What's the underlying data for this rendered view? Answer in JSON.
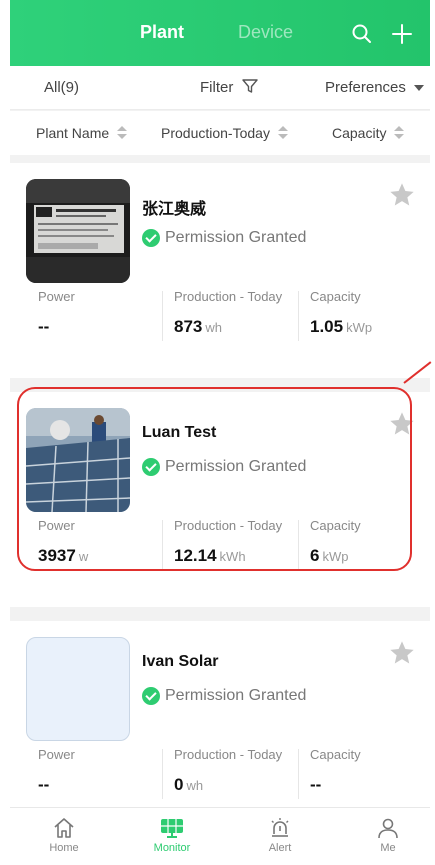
{
  "header": {
    "tab_plant": "Plant",
    "tab_device": "Device"
  },
  "filters": {
    "all": "All(9)",
    "filter": "Filter",
    "preferences": "Preferences"
  },
  "sort": {
    "plant_name": "Plant Name",
    "production_today": "Production-Today",
    "capacity": "Capacity"
  },
  "metric_labels": {
    "power": "Power",
    "production": "Production - Today",
    "capacity": "Capacity"
  },
  "plants": [
    {
      "name": "张江奥威",
      "permission": "Permission Granted",
      "power": "--",
      "power_unit": "",
      "production": "873",
      "production_unit": "wh",
      "capacity": "1.05",
      "capacity_unit": "kWp"
    },
    {
      "name": "Luan Test",
      "permission": "Permission Granted",
      "power": "3937",
      "power_unit": "w",
      "production": "12.14",
      "production_unit": "kWh",
      "capacity": "6",
      "capacity_unit": "kWp"
    },
    {
      "name": "Ivan Solar",
      "permission": "Permission Granted",
      "power": "--",
      "power_unit": "",
      "production": "0",
      "production_unit": "wh",
      "capacity": "--",
      "capacity_unit": ""
    }
  ],
  "nav": {
    "home": "Home",
    "monitor": "Monitor",
    "alert": "Alert",
    "me": "Me"
  },
  "colors": {
    "brand_green": "#2ecc71",
    "highlight_red": "#e0302d",
    "star_gray": "#c8c8c8"
  }
}
